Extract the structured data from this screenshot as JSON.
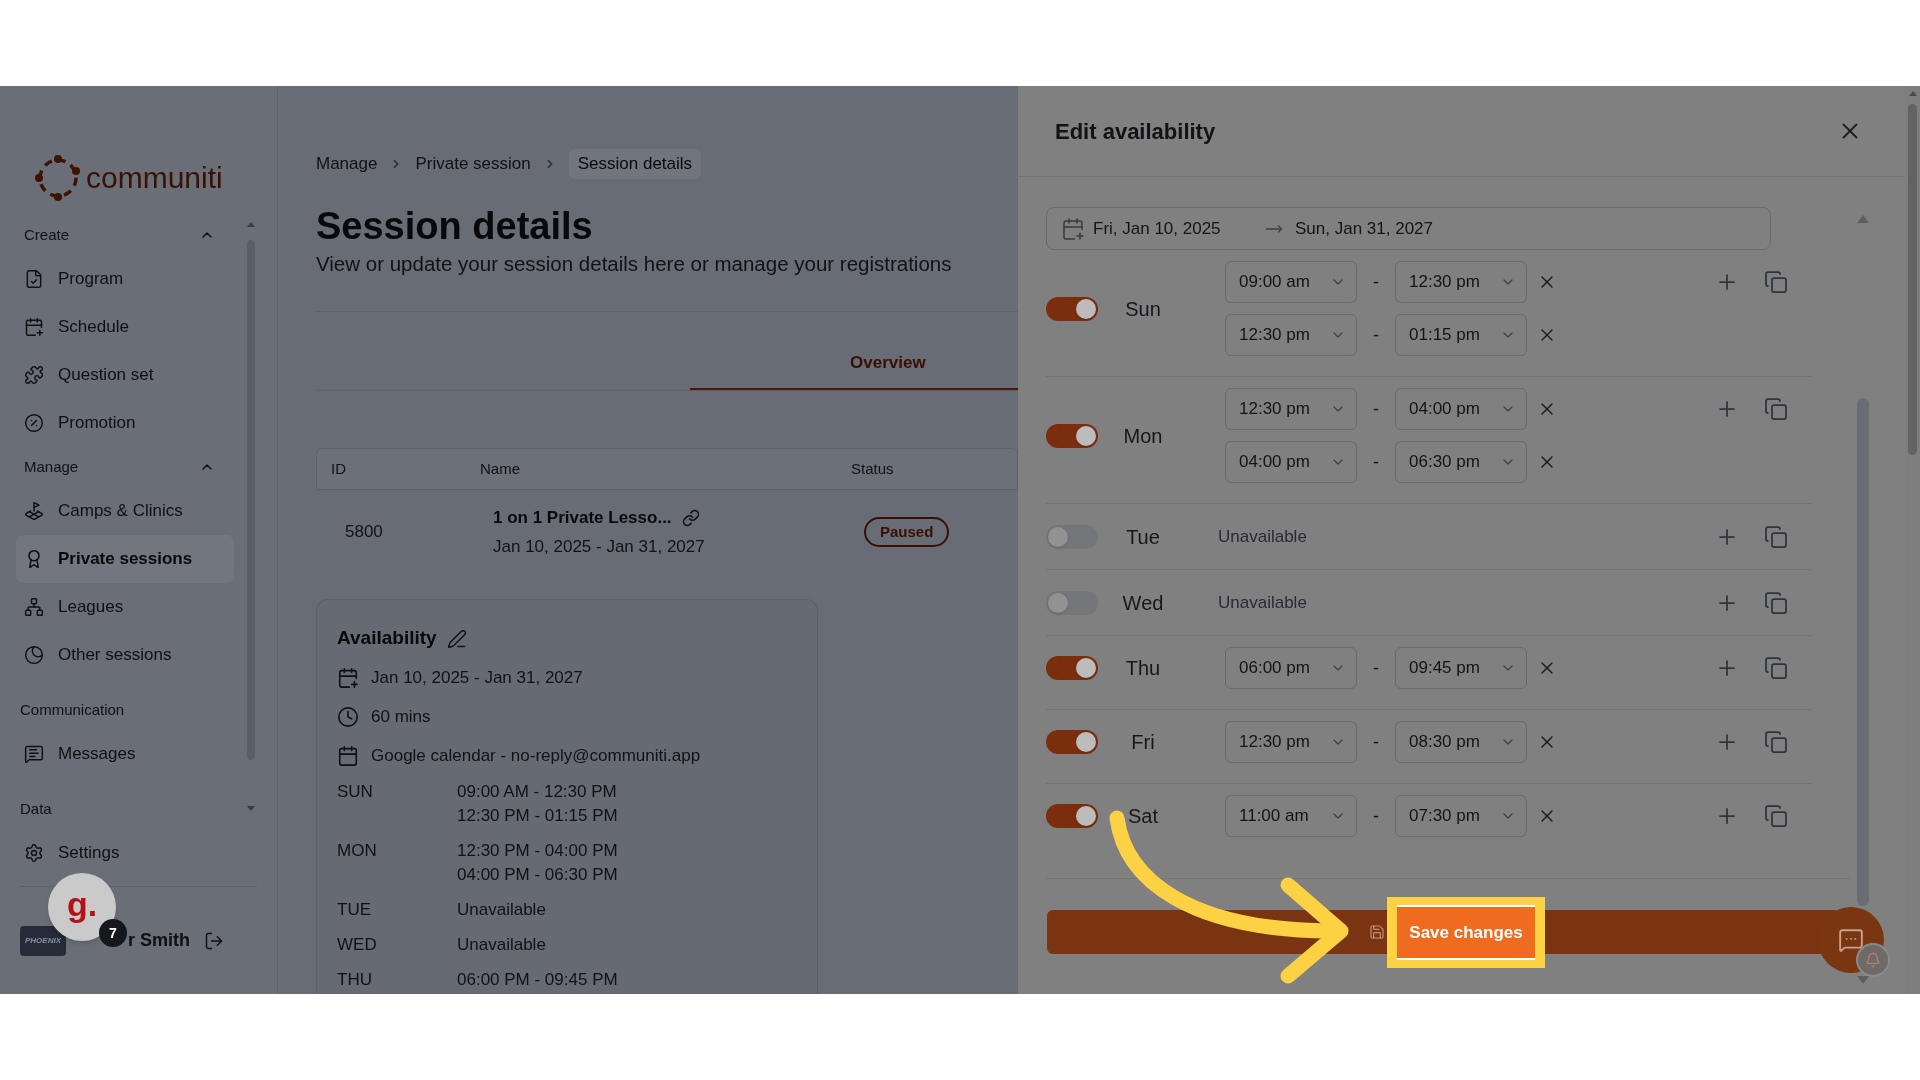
{
  "sidebar": {
    "logo": "communiti",
    "sections": [
      {
        "title": "Create",
        "expanded": true,
        "items": [
          {
            "label": "Program",
            "selected": false
          },
          {
            "label": "Schedule",
            "selected": false
          },
          {
            "label": "Question set",
            "selected": false
          },
          {
            "label": "Promotion",
            "selected": false
          }
        ]
      },
      {
        "title": "Manage",
        "expanded": true,
        "items": [
          {
            "label": "Camps & Clinics",
            "selected": false
          },
          {
            "label": "Private sessions",
            "selected": true
          },
          {
            "label": "Leagues",
            "selected": false
          },
          {
            "label": "Other sessions",
            "selected": false
          }
        ]
      },
      {
        "title": "Communication",
        "items": [
          {
            "label": "Messages",
            "selected": false
          }
        ]
      },
      {
        "title": "Data",
        "items": [
          {
            "label": "Settings",
            "selected": false
          }
        ]
      }
    ],
    "user": {
      "team_logo": "PHOENIX",
      "name": "r Smith"
    }
  },
  "help_widget": {
    "label": "g.",
    "badge": "7"
  },
  "main": {
    "breadcrumbs": [
      {
        "label": "Manage",
        "current": false
      },
      {
        "label": "Private session",
        "current": false
      },
      {
        "label": "Session details",
        "current": true
      }
    ],
    "title": "Session details",
    "subtitle": "View or update your session details here or manage your registrations",
    "tabs": [
      {
        "label": "Overview",
        "selected": true
      }
    ],
    "table": {
      "columns": [
        "ID",
        "Name",
        "Status"
      ],
      "rows": [
        {
          "id": "5800",
          "name": "1 on 1 Private Lesso...",
          "dates": "Jan 10, 2025 - Jan 31, 2027",
          "status": "Paused"
        }
      ]
    },
    "availability": {
      "title": "Availability",
      "details": [
        "Jan 10, 2025 - Jan 31, 2027",
        "60 mins",
        "Google calendar - no-reply@communiti.app"
      ],
      "schedule": [
        {
          "day": "SUN",
          "times": [
            "09:00 AM - 12:30 PM",
            "12:30 PM - 01:15 PM"
          ]
        },
        {
          "day": "MON",
          "times": [
            "12:30 PM - 04:00 PM",
            "04:00 PM - 06:30 PM"
          ]
        },
        {
          "day": "TUE",
          "times": [
            "Unavailable"
          ]
        },
        {
          "day": "WED",
          "times": [
            "Unavailable"
          ]
        },
        {
          "day": "THU",
          "times": [
            "06:00 PM - 09:45 PM"
          ]
        }
      ]
    }
  },
  "drawer": {
    "title": "Edit availability",
    "date_range": {
      "start": "Fri, Jan 10, 2025",
      "end": "Sun, Jan 31, 2027"
    },
    "days": [
      {
        "day": "Sun",
        "on": true,
        "slots": [
          {
            "start": "09:00 am",
            "separator": "-",
            "end": "12:30 pm"
          },
          {
            "start": "12:30 pm",
            "separator": "-",
            "end": "01:15 pm"
          }
        ]
      },
      {
        "day": "Mon",
        "on": true,
        "slots": [
          {
            "start": "12:30 pm",
            "separator": "-",
            "end": "04:00 pm"
          },
          {
            "start": "04:00 pm",
            "separator": "-",
            "end": "06:30 pm"
          }
        ]
      },
      {
        "day": "Tue",
        "on": false,
        "status": "Unavailable"
      },
      {
        "day": "Wed",
        "on": false,
        "status": "Unavailable"
      },
      {
        "day": "Thu",
        "on": true,
        "slots": [
          {
            "start": "06:00 pm",
            "separator": "-",
            "end": "09:45 pm"
          }
        ]
      },
      {
        "day": "Fri",
        "on": true,
        "slots": [
          {
            "start": "12:30 pm",
            "separator": "-",
            "end": "08:30 pm"
          }
        ]
      },
      {
        "day": "Sat",
        "on": true,
        "slots": [
          {
            "start": "11:00 am",
            "separator": "-",
            "end": "07:30 pm"
          }
        ]
      }
    ],
    "save_button": {
      "label": "Save changes",
      "highlighted": true
    }
  }
}
